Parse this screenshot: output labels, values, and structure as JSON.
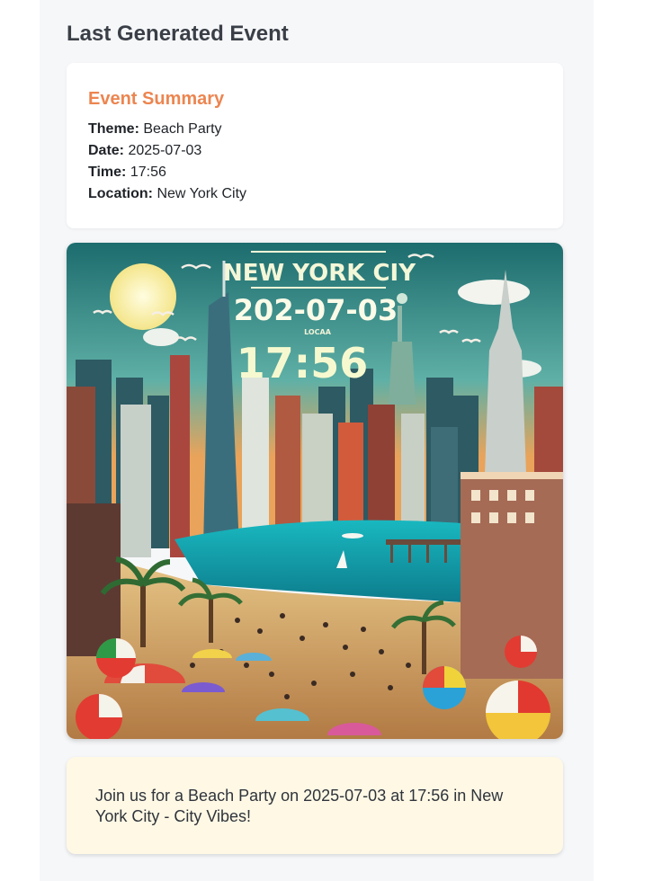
{
  "section": {
    "title": "Last Generated Event"
  },
  "summary": {
    "heading": "Event Summary",
    "rows": [
      {
        "label": "Theme:",
        "value": "Beach Party"
      },
      {
        "label": "Date:",
        "value": "2025-07-03"
      },
      {
        "label": "Time:",
        "value": "17:56"
      },
      {
        "label": "Location:",
        "value": "New York City"
      }
    ]
  },
  "poster": {
    "headline": "NEW YORK CIY",
    "date_text": "202-07-03",
    "small_text": "LOCAA",
    "time_text": "17:56"
  },
  "message": {
    "text": "Join us for a Beach Party on 2025-07-03 at 17:56 in New York City - City Vibes!"
  },
  "colors": {
    "accent": "#ec8550",
    "message_bg": "#fff8e5",
    "panel_bg": "#f6f7f9"
  }
}
